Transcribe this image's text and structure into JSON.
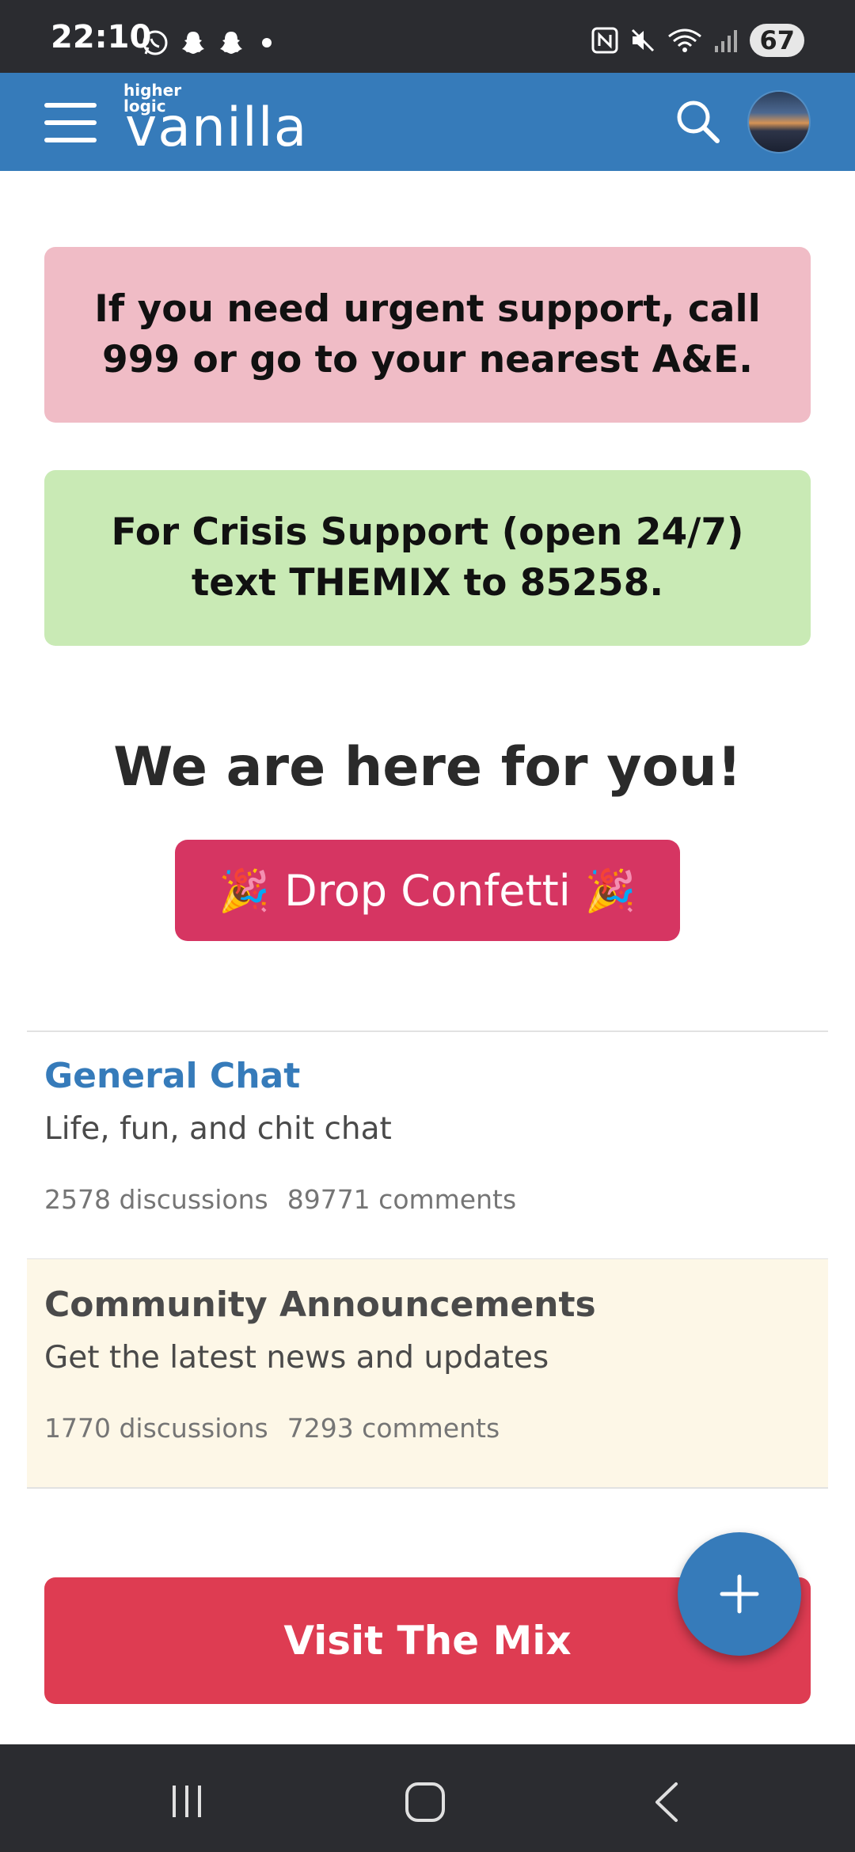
{
  "status_bar": {
    "time": "22:10",
    "left_icons": [
      "whatsapp-icon",
      "snapchat-icon",
      "snapchat-icon",
      "dot-icon"
    ],
    "right_icons": [
      "nfc-icon",
      "mute-icon",
      "wifi-icon",
      "signal-icon"
    ],
    "battery": "67"
  },
  "header": {
    "logo_small": "higher logic",
    "logo_main": "vanilla",
    "brand_color": "#367bba"
  },
  "banners": {
    "urgent": "If you need urgent support, call 999 or go to your nearest A&E.",
    "crisis": "For Crisis Support (open 24/7) text THEMIX to 85258.",
    "urgent_color": "#f0bcc6",
    "crisis_color": "#c9eab5"
  },
  "hero": {
    "title": "We are here for you!",
    "confetti_label": "Drop Confetti",
    "confetti_emoji": "🎉",
    "confetti_color": "#d63562"
  },
  "categories": [
    {
      "title": "General Chat",
      "description": "Life, fun, and chit chat",
      "discussions": "2578 discussions",
      "comments": "89771 comments"
    },
    {
      "title": "Community Announcements",
      "description": "Get the latest news and updates",
      "discussions": "1770 discussions",
      "comments": "7293 comments"
    }
  ],
  "visit_button": {
    "label": "Visit The Mix",
    "color": "#de3c52"
  },
  "fab": {
    "icon": "plus-icon"
  },
  "nav_bar": {
    "icons": [
      "recents-icon",
      "home-icon",
      "back-icon"
    ]
  }
}
